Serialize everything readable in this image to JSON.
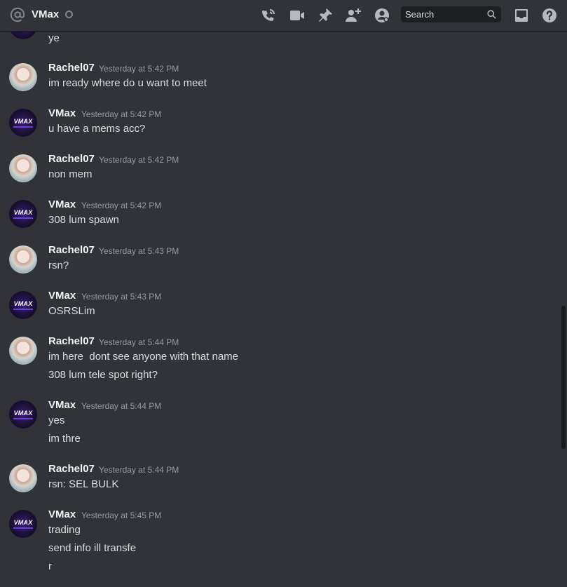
{
  "header": {
    "title": "VMax",
    "search_placeholder": "Search",
    "icons": [
      "at-icon",
      "phone-call-icon",
      "video-camera-icon",
      "pin-icon",
      "add-friend-icon",
      "user-profile-icon",
      "inbox-icon",
      "help-icon"
    ]
  },
  "messages": [
    {
      "author": "",
      "time": "",
      "lines": [
        "ye"
      ],
      "avatar": "vmax"
    },
    {
      "author": "Rachel07",
      "time": "Yesterday at 5:42 PM",
      "lines": [
        "im ready where do u want to meet"
      ],
      "avatar": "rachel"
    },
    {
      "author": "VMax",
      "time": "Yesterday at 5:42 PM",
      "lines": [
        "u have a mems acc?"
      ],
      "avatar": "vmax"
    },
    {
      "author": "Rachel07",
      "time": "Yesterday at 5:42 PM",
      "lines": [
        "non mem"
      ],
      "avatar": "rachel"
    },
    {
      "author": "VMax",
      "time": "Yesterday at 5:42 PM",
      "lines": [
        "308 lum spawn"
      ],
      "avatar": "vmax"
    },
    {
      "author": "Rachel07",
      "time": "Yesterday at 5:43 PM",
      "lines": [
        "rsn?"
      ],
      "avatar": "rachel"
    },
    {
      "author": "VMax",
      "time": "Yesterday at 5:43 PM",
      "lines": [
        "OSRSLim"
      ],
      "avatar": "vmax"
    },
    {
      "author": "Rachel07",
      "time": "Yesterday at 5:44 PM",
      "lines": [
        "im here  dont see anyone with that name",
        "308 lum tele spot right?"
      ],
      "avatar": "rachel"
    },
    {
      "author": "VMax",
      "time": "Yesterday at 5:44 PM",
      "lines": [
        "yes",
        "im thre"
      ],
      "avatar": "vmax"
    },
    {
      "author": "Rachel07",
      "time": "Yesterday at 5:44 PM",
      "lines": [
        "rsn: SEL BULK"
      ],
      "avatar": "rachel"
    },
    {
      "author": "VMax",
      "time": "Yesterday at 5:45 PM",
      "lines": [
        "trading",
        "send info ill transfe",
        "r"
      ],
      "avatar": "vmax"
    }
  ],
  "avatar_text": {
    "vmax": "VMAX"
  },
  "colors": {
    "background": "#313338",
    "header_border": "#1f2023",
    "text": "#dbdee1",
    "author": "#f2f3f5",
    "timestamp": "#949ba4",
    "icon": "#b5bac1"
  }
}
